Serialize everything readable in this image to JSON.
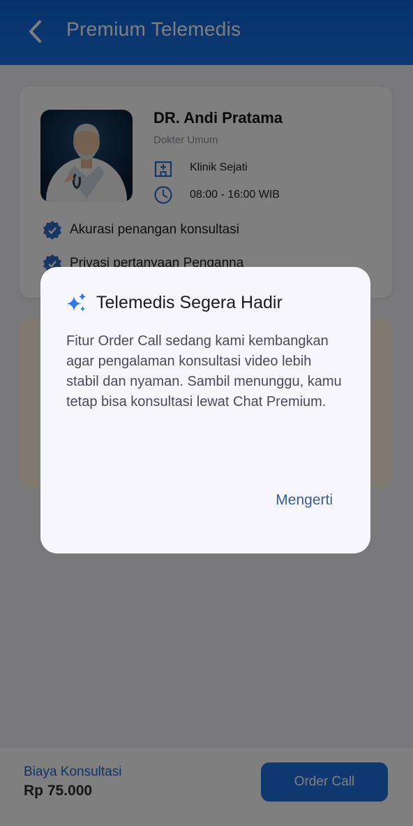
{
  "app_bar": {
    "title": "Premium Telemedis",
    "back_icon": "chevron-left-icon"
  },
  "doctor": {
    "name": "DR. Andi Pratama",
    "specialty": "Dokter Umum",
    "clinic": "Klinik Sejati",
    "hours": "08:00 - 16:00 WIB",
    "features": [
      "Akurasi penangan konsultasi",
      "Privasi pertanyaan Penganna"
    ]
  },
  "footer": {
    "fee_label": "Biaya Konsultasi",
    "fee_value": "Rp 75.000",
    "order_label": "Order Call"
  },
  "dialog": {
    "icon": "sparkle-icon",
    "title": "Telemedis Segera Hadir",
    "body": "Fitur Order Call sedang kami kembangkan agar pengalaman konsultasi video lebih stabil dan nyaman. Sambil menunggu, kamu tetap bisa konsultasi lewat Chat Premium.",
    "action": "Mengerti"
  },
  "colors": {
    "primary": "#1f6fe0",
    "scrim": "rgba(0,0,0,0.5)",
    "dialog_bg": "#f7f6fd",
    "accent_text": "#3a5d92"
  }
}
